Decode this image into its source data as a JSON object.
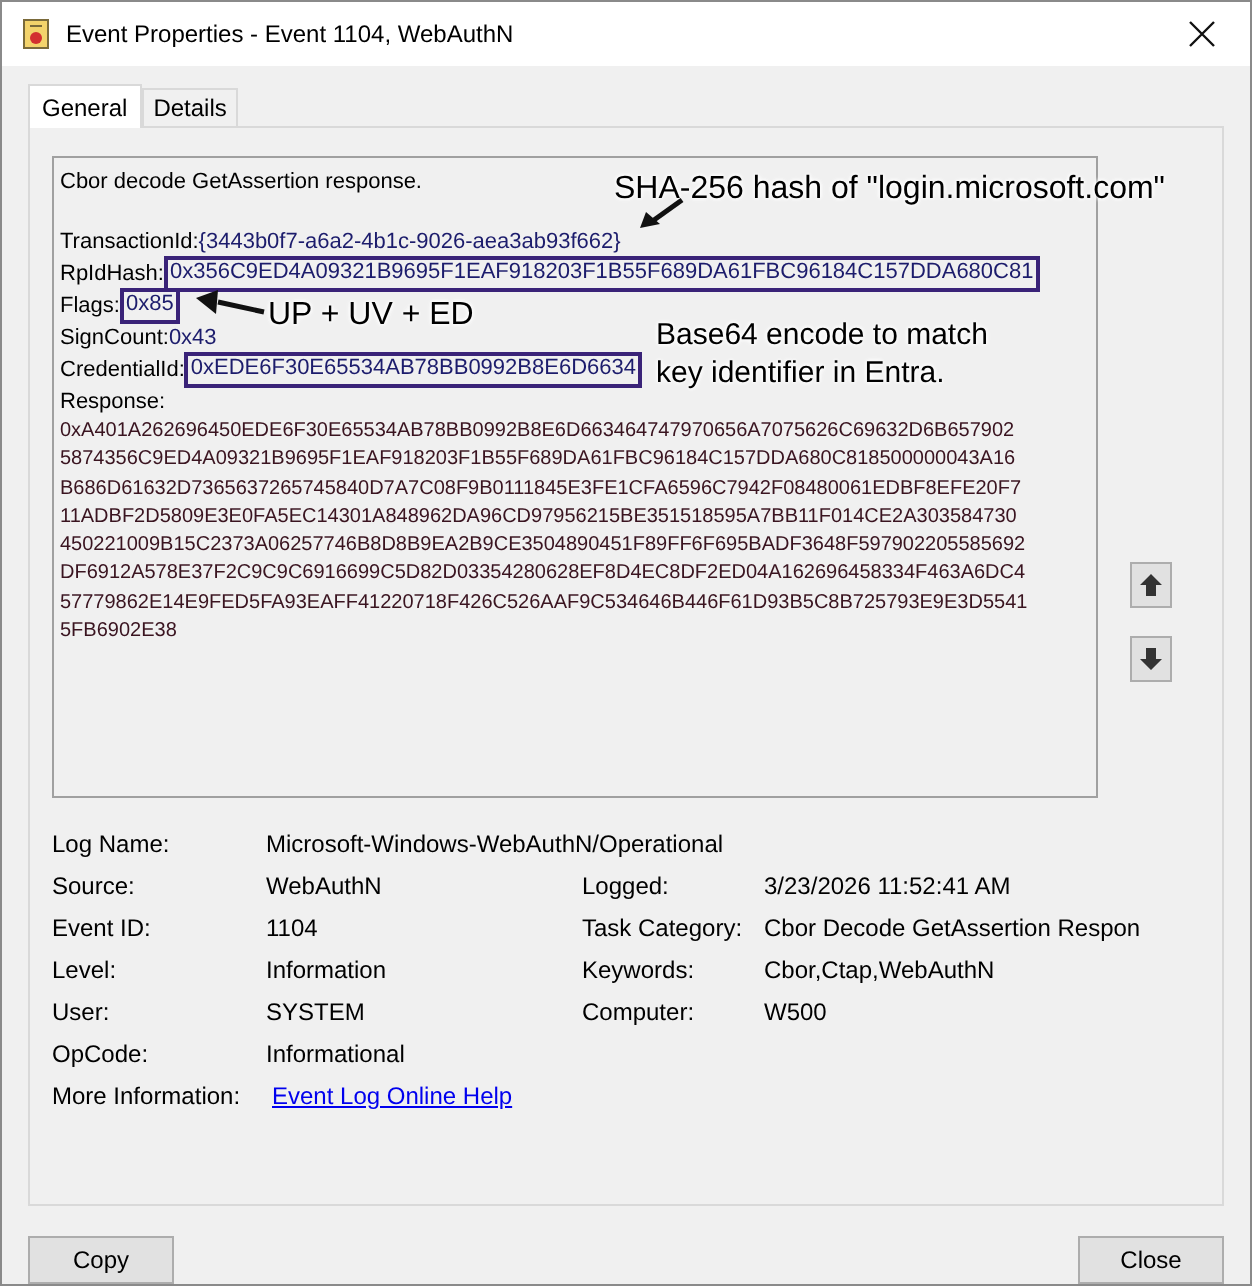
{
  "window": {
    "title": "Event Properties - Event 1104, WebAuthN"
  },
  "tabs": [
    {
      "label": "General",
      "selected": true
    },
    {
      "label": "Details",
      "selected": false
    }
  ],
  "description": {
    "heading": "Cbor decode GetAssertion response.",
    "fields": [
      {
        "label": "TransactionId:",
        "value": "{3443b0f7-a6a2-4b1c-9026-aea3ab93f662}",
        "highlighted": false
      },
      {
        "label": "RpIdHash:",
        "value": "0x356C9ED4A09321B9695F1EAF918203F1B55F689DA61FBC96184C157DDA680C81",
        "highlighted": true
      },
      {
        "label": "Flags:",
        "value": "0x85",
        "highlighted": true
      },
      {
        "label": "SignCount:",
        "value": "0x43",
        "highlighted": false
      },
      {
        "label": "CredentialId:",
        "value": "0xEDE6F30E65534AB78BB0992B8E6D6634",
        "highlighted": true
      }
    ],
    "response_label": "Response:",
    "response_lines": [
      "0xA401A262696450EDE6F30E65534AB78BB0992B8E6D663464747970656A7075626C69632D6B657902",
      "5874356C9ED4A09321B9695F1EAF918203F1B55F689DA61FBC96184C157DDA680C818500000043A16",
      "B686D61632D7365637265745840D7A7C08F9B0111845E3FE1CFA6596C7942F08480061EDBF8EFE20F7",
      "11ADBF2D5809E3E0FA5EC14301A848962DA96CD97956215BE351518595A7BB11F014CE2A303584730",
      "450221009B15C2373A06257746B8D8B9EA2B9CE3504890451F89FF6F695BADF3648F597902205585692",
      "DF6912A578E37F2C9C9C6916699C5D82D03354280628EF8D4EC8DF2ED04A162696458334F463A6DC4",
      "57779862E14E9FED5FA93EAFF41220718F426C526AAF9C534646B446F61D93B5C8B725793E9E3D5541",
      "5FB6902E38"
    ]
  },
  "annotations": [
    {
      "text": "SHA-256 hash of \"login.microsoft.com\""
    },
    {
      "text": "UP + UV + ED"
    },
    {
      "text": "Base64 encode to match key identifier in Entra."
    }
  ],
  "details": [
    {
      "cells": [
        {
          "label": "Log Name:",
          "value": "Microsoft-Windows-WebAuthN/Operational"
        }
      ]
    },
    {
      "cells": [
        {
          "label": "Source:",
          "value": "WebAuthN"
        },
        {
          "label": "Logged:",
          "value": "3/23/2026 11:52:41 AM"
        }
      ]
    },
    {
      "cells": [
        {
          "label": "Event ID:",
          "value": "1104"
        },
        {
          "label": "Task Category:",
          "value": "Cbor Decode GetAssertion Respon"
        }
      ]
    },
    {
      "cells": [
        {
          "label": "Level:",
          "value": "Information"
        },
        {
          "label": "Keywords:",
          "value": "Cbor,Ctap,WebAuthN"
        }
      ]
    },
    {
      "cells": [
        {
          "label": "User:",
          "value": "SYSTEM"
        },
        {
          "label": "Computer:",
          "value": "W500"
        }
      ]
    },
    {
      "cells": [
        {
          "label": "OpCode:",
          "value": "Informational"
        }
      ]
    }
  ],
  "more_information": {
    "label": "More Information:",
    "link": "Event Log Online Help"
  },
  "buttons": [
    "Copy",
    "Close"
  ]
}
